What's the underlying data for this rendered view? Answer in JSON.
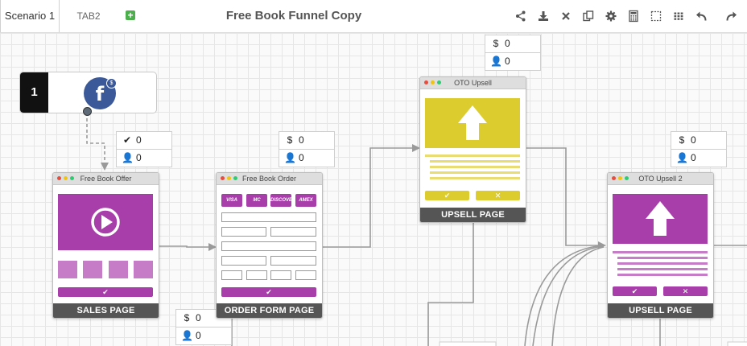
{
  "tabs": [
    {
      "label": "Scenario 1",
      "active": true
    },
    {
      "label": "TAB2",
      "active": false
    }
  ],
  "add_tab_symbol": "+",
  "funnel_title": "Free Book Funnel Copy",
  "toolbar_icons": [
    "share-icon",
    "download-icon",
    "close-icon",
    "copy-icon",
    "gear-icon",
    "calculator-icon",
    "select-icon",
    "grid-icon",
    "undo-icon",
    "redo-icon"
  ],
  "colors": {
    "purple": "#a73ea9",
    "yellow": "#ddcc2e",
    "facebook": "#3b5998",
    "footer": "#555555"
  },
  "source": {
    "number": "1",
    "icon_letter": "f",
    "badge": "$"
  },
  "stats": {
    "sales": {
      "clicks": "0",
      "people": "0"
    },
    "order": {
      "money": "0",
      "people": "0"
    },
    "oto1": {
      "money": "0",
      "people": "0"
    },
    "oto2": {
      "money": "0",
      "people": "0"
    },
    "order_bottom": {
      "money": "0",
      "people": "0"
    }
  },
  "stat_symbols": {
    "money": "$",
    "check": "✔",
    "person": "👤"
  },
  "pages": {
    "sales": {
      "header": "Free Book Offer",
      "footer": "SALES PAGE",
      "button": "✔"
    },
    "order": {
      "header": "Free Book Order",
      "footer": "ORDER FORM PAGE",
      "button": "✔",
      "cards": [
        "VISA",
        "MC",
        "DISCOVER",
        "AMEX"
      ]
    },
    "oto1": {
      "header": "OTO Upsell",
      "footer": "UPSELL PAGE",
      "yes": "✔",
      "no": "✕"
    },
    "oto2": {
      "header": "OTO Upsell 2",
      "footer": "UPSELL PAGE",
      "yes": "✔",
      "no": "✕"
    }
  }
}
